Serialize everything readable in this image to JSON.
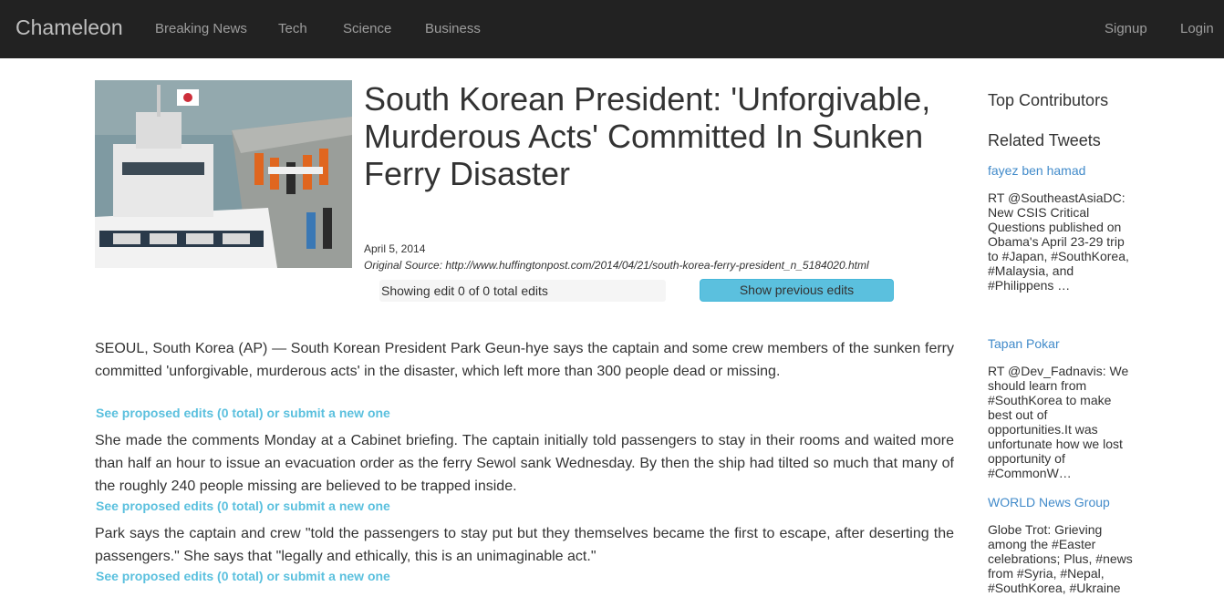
{
  "navbar": {
    "brand": "Chameleon",
    "links": [
      "Breaking News",
      "Tech",
      "Science",
      "Business"
    ],
    "right_links": [
      "Signup",
      "Login"
    ]
  },
  "article": {
    "title": "South Korean President: 'Unforgivable, Murderous Acts' Committed In Sunken Ferry Disaster",
    "date": "April 5, 2014",
    "source": "Original Source: http://www.huffingtonpost.com/2014/04/21/south-korea-ferry-president_n_5184020.html",
    "edit_status": "Showing edit 0 of 0 total edits",
    "show_edits_label": "Show previous edits",
    "paragraphs": [
      {
        "text": "SEOUL, South Korea (AP) — South Korean President Park Geun-hye says the captain and some crew members of the sunken ferry committed 'unforgivable, murderous acts' in the disaster, which left more than 300 people dead or missing.",
        "edits_link": "See proposed edits (0 total) or submit a new one"
      },
      {
        "text": "She made the comments Monday at a Cabinet briefing. The captain initially told passengers to stay in their rooms and waited more than half an hour to issue an evacuation order as the ferry Sewol sank Wednesday. By then the ship had tilted so much that many of the roughly 240 people missing are believed to be trapped inside.",
        "edits_link": "See proposed edits (0 total) or submit a new one"
      },
      {
        "text": "Park says the captain and crew \"told the passengers to stay put but they themselves became the first to escape, after deserting the passengers.\" She says that \"legally and ethically, this is an unimaginable act.\"",
        "edits_link": "See proposed edits (0 total) or submit a new one"
      }
    ]
  },
  "sidebar": {
    "top_contributors_heading": "Top Contributors",
    "related_tweets_heading": "Related Tweets",
    "tweets": [
      {
        "author": "fayez ben hamad",
        "text": "RT @SoutheastAsiaDC: New CSIS Critical Questions published on Obama's April 23-29 trip to #Japan, #SouthKorea, #Malaysia, and #Philippens …"
      },
      {
        "author": "Tapan Pokar",
        "text": "RT @Dev_Fadnavis: We should learn from #SouthKorea to make best out of opportunities.It was unfortunate how we lost opportunity of #CommonW…"
      },
      {
        "author": "WORLD News Group",
        "text": "Globe Trot: Grieving among the #Easter celebrations; Plus, #news from #Syria, #Nepal, #SouthKorea, #Ukraine"
      }
    ]
  }
}
